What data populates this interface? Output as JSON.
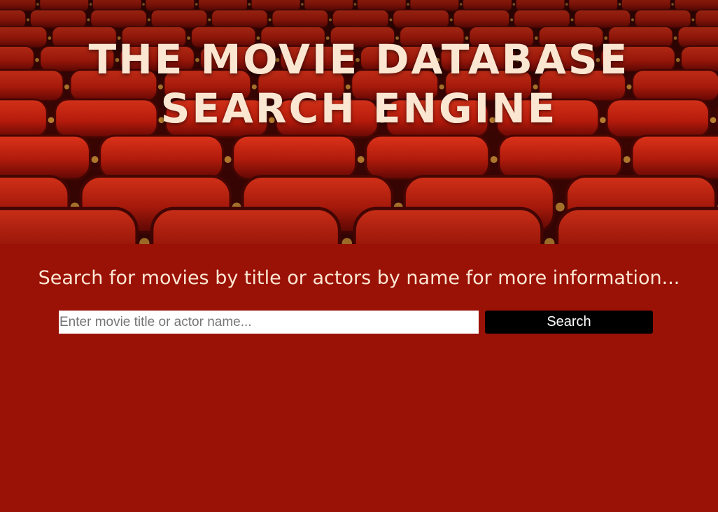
{
  "header": {
    "title": "THE MOVIE DATABASE SEARCH ENGINE",
    "background": "theater-seats-image"
  },
  "main": {
    "subtitle": "Search for movies by title or actors by name for more information...",
    "search": {
      "placeholder": "Enter movie title or actor name...",
      "value": "",
      "button_label": "Search"
    }
  },
  "colors": {
    "page_background": "#9a1106",
    "title_text": "#fbe6d2",
    "button_background": "#000000",
    "button_text": "#ffffff"
  }
}
